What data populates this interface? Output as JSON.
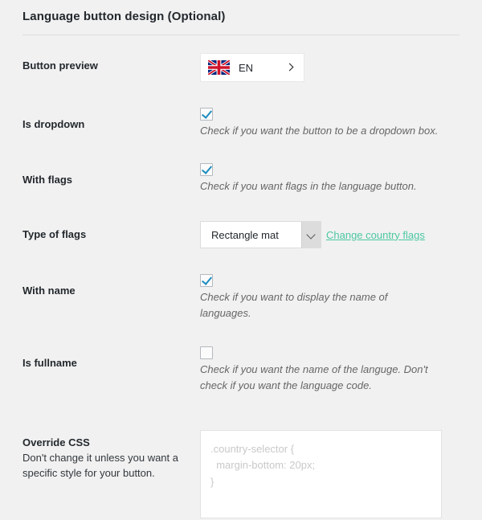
{
  "section": {
    "title": "Language button design (Optional)"
  },
  "rows": {
    "button_preview": {
      "label": "Button preview",
      "flag_icon": "uk-flag-icon",
      "code": "EN",
      "arrow_icon": "chevron-right-icon"
    },
    "is_dropdown": {
      "label": "Is dropdown",
      "checked": true,
      "description": "Check if you want the button to be a dropdown box."
    },
    "with_flags": {
      "label": "With flags",
      "checked": true,
      "description": "Check if you want flags in the language button."
    },
    "type_of_flags": {
      "label": "Type of flags",
      "selected": "Rectangle mat",
      "arrow_icon": "chevron-down-icon",
      "link": "Change country flags"
    },
    "with_name": {
      "label": "With name",
      "checked": true,
      "description": "Check if you want to display the name of languages."
    },
    "is_fullname": {
      "label": "Is fullname",
      "checked": false,
      "description": "Check if you want the name of the languge. Don't check if you want the language code."
    },
    "override_css": {
      "label": "Override CSS",
      "sublabel": "Don't change it unless you want a specific style for your button.",
      "value": "",
      "placeholder": ".country-selector {\n  margin-bottom: 20px;\n}"
    }
  },
  "colors": {
    "page_background": "#f1f1f1",
    "heading_text": "#23282d",
    "description_text": "#666666",
    "link_accent": "#4cc8a0",
    "checkbox_check": "#1e8cbe",
    "placeholder_text": "#c9c9c9"
  }
}
